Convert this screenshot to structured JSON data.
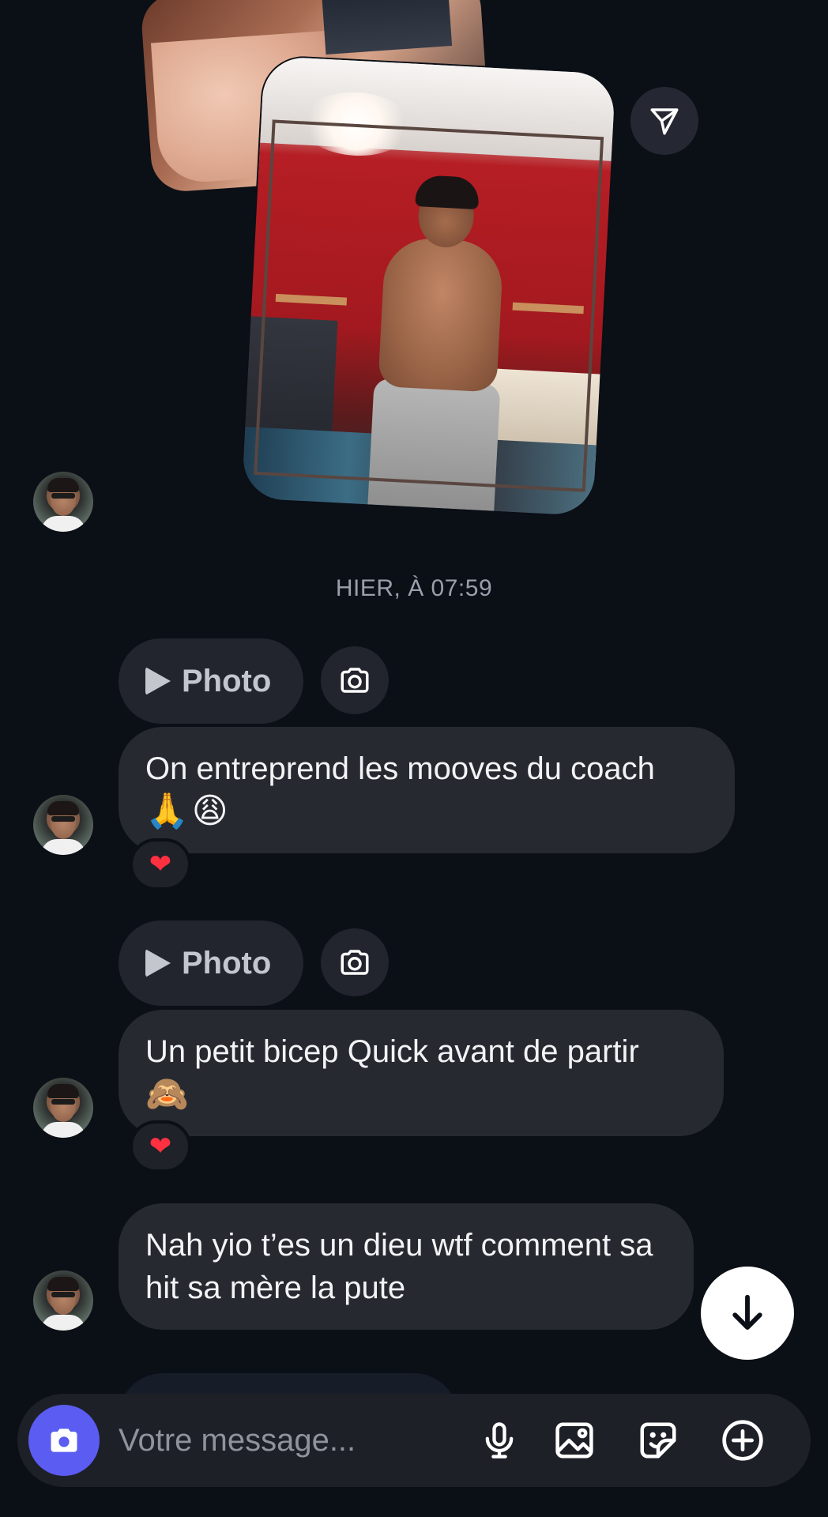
{
  "timestamp": "HIER, À 07:59",
  "messages": [
    {
      "reply_label": "Photo",
      "text": "On entreprend les mooves du coach",
      "emoji": "🙏😩",
      "reaction": "❤"
    },
    {
      "reply_label": "Photo",
      "text": "Un petit bicep Quick avant de partir",
      "emoji": "🙈",
      "reaction": "❤"
    },
    {
      "text": "Nah yio t’es un dieu wtf comment sa hit sa mère la pute"
    }
  ],
  "composer": {
    "placeholder": "Votre message..."
  },
  "icons": {
    "share": "send-icon",
    "reply_play": "play-icon",
    "reply_camera": "camera-icon",
    "scroll": "arrow-down-icon",
    "composer_camera": "camera-icon",
    "mic": "microphone-icon",
    "gallery": "image-icon",
    "sticker": "sticker-icon",
    "plus": "plus-circle-icon"
  },
  "colors": {
    "background": "#0b0f16",
    "bubble": "#262930",
    "accent": "#5b5cf2",
    "heart": "#ff3040"
  }
}
